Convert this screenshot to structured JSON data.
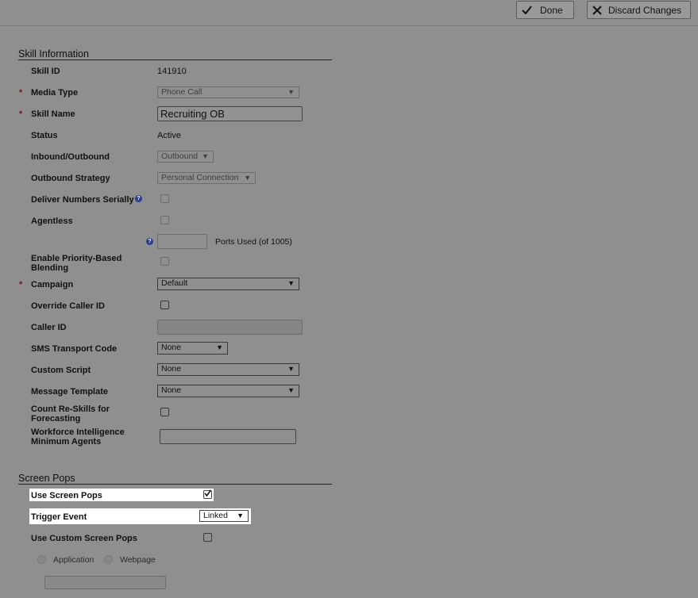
{
  "toolbar": {
    "done_label": "Done",
    "discard_label": "Discard Changes"
  },
  "skill_info": {
    "section_title": "Skill Information",
    "skill_id_label": "Skill ID",
    "skill_id_value": "141910",
    "media_type_label": "Media Type",
    "media_type_value": "Phone Call",
    "skill_name_label": "Skill Name",
    "skill_name_value": "Recruiting OB",
    "status_label": "Status",
    "status_value": "Active",
    "inbound_outbound_label": "Inbound/Outbound",
    "inbound_outbound_value": "Outbound",
    "outbound_strategy_label": "Outbound Strategy",
    "outbound_strategy_value": "Personal Connection",
    "deliver_numbers_label": "Deliver Numbers Serially",
    "agentless_label": "Agentless",
    "ports_used_label": "Ports Used (of 1005)",
    "priority_blending_label_1": "Enable Priority-Based",
    "priority_blending_label_2": "Blending",
    "campaign_label": "Campaign",
    "campaign_value": "Default",
    "override_caller_id_label": "Override Caller ID",
    "caller_id_label": "Caller ID",
    "sms_transport_label": "SMS Transport Code",
    "sms_transport_value": "None",
    "custom_script_label": "Custom Script",
    "custom_script_value": "None",
    "message_template_label": "Message Template",
    "message_template_value": "None",
    "count_reskills_label_1": "Count Re-Skills for",
    "count_reskills_label_2": "Forecasting",
    "wfi_label_1": "Workforce Intelligence",
    "wfi_label_2": "Minimum Agents",
    "required_mark": "*",
    "help_glyph": "?",
    "arrow_glyph": "▼"
  },
  "screen_pops": {
    "section_title": "Screen Pops",
    "use_screen_pops_label": "Use Screen Pops",
    "trigger_event_label": "Trigger Event",
    "trigger_event_value": "Linked",
    "use_custom_label": "Use Custom Screen Pops",
    "application_label": "Application",
    "webpage_label": "Webpage"
  }
}
